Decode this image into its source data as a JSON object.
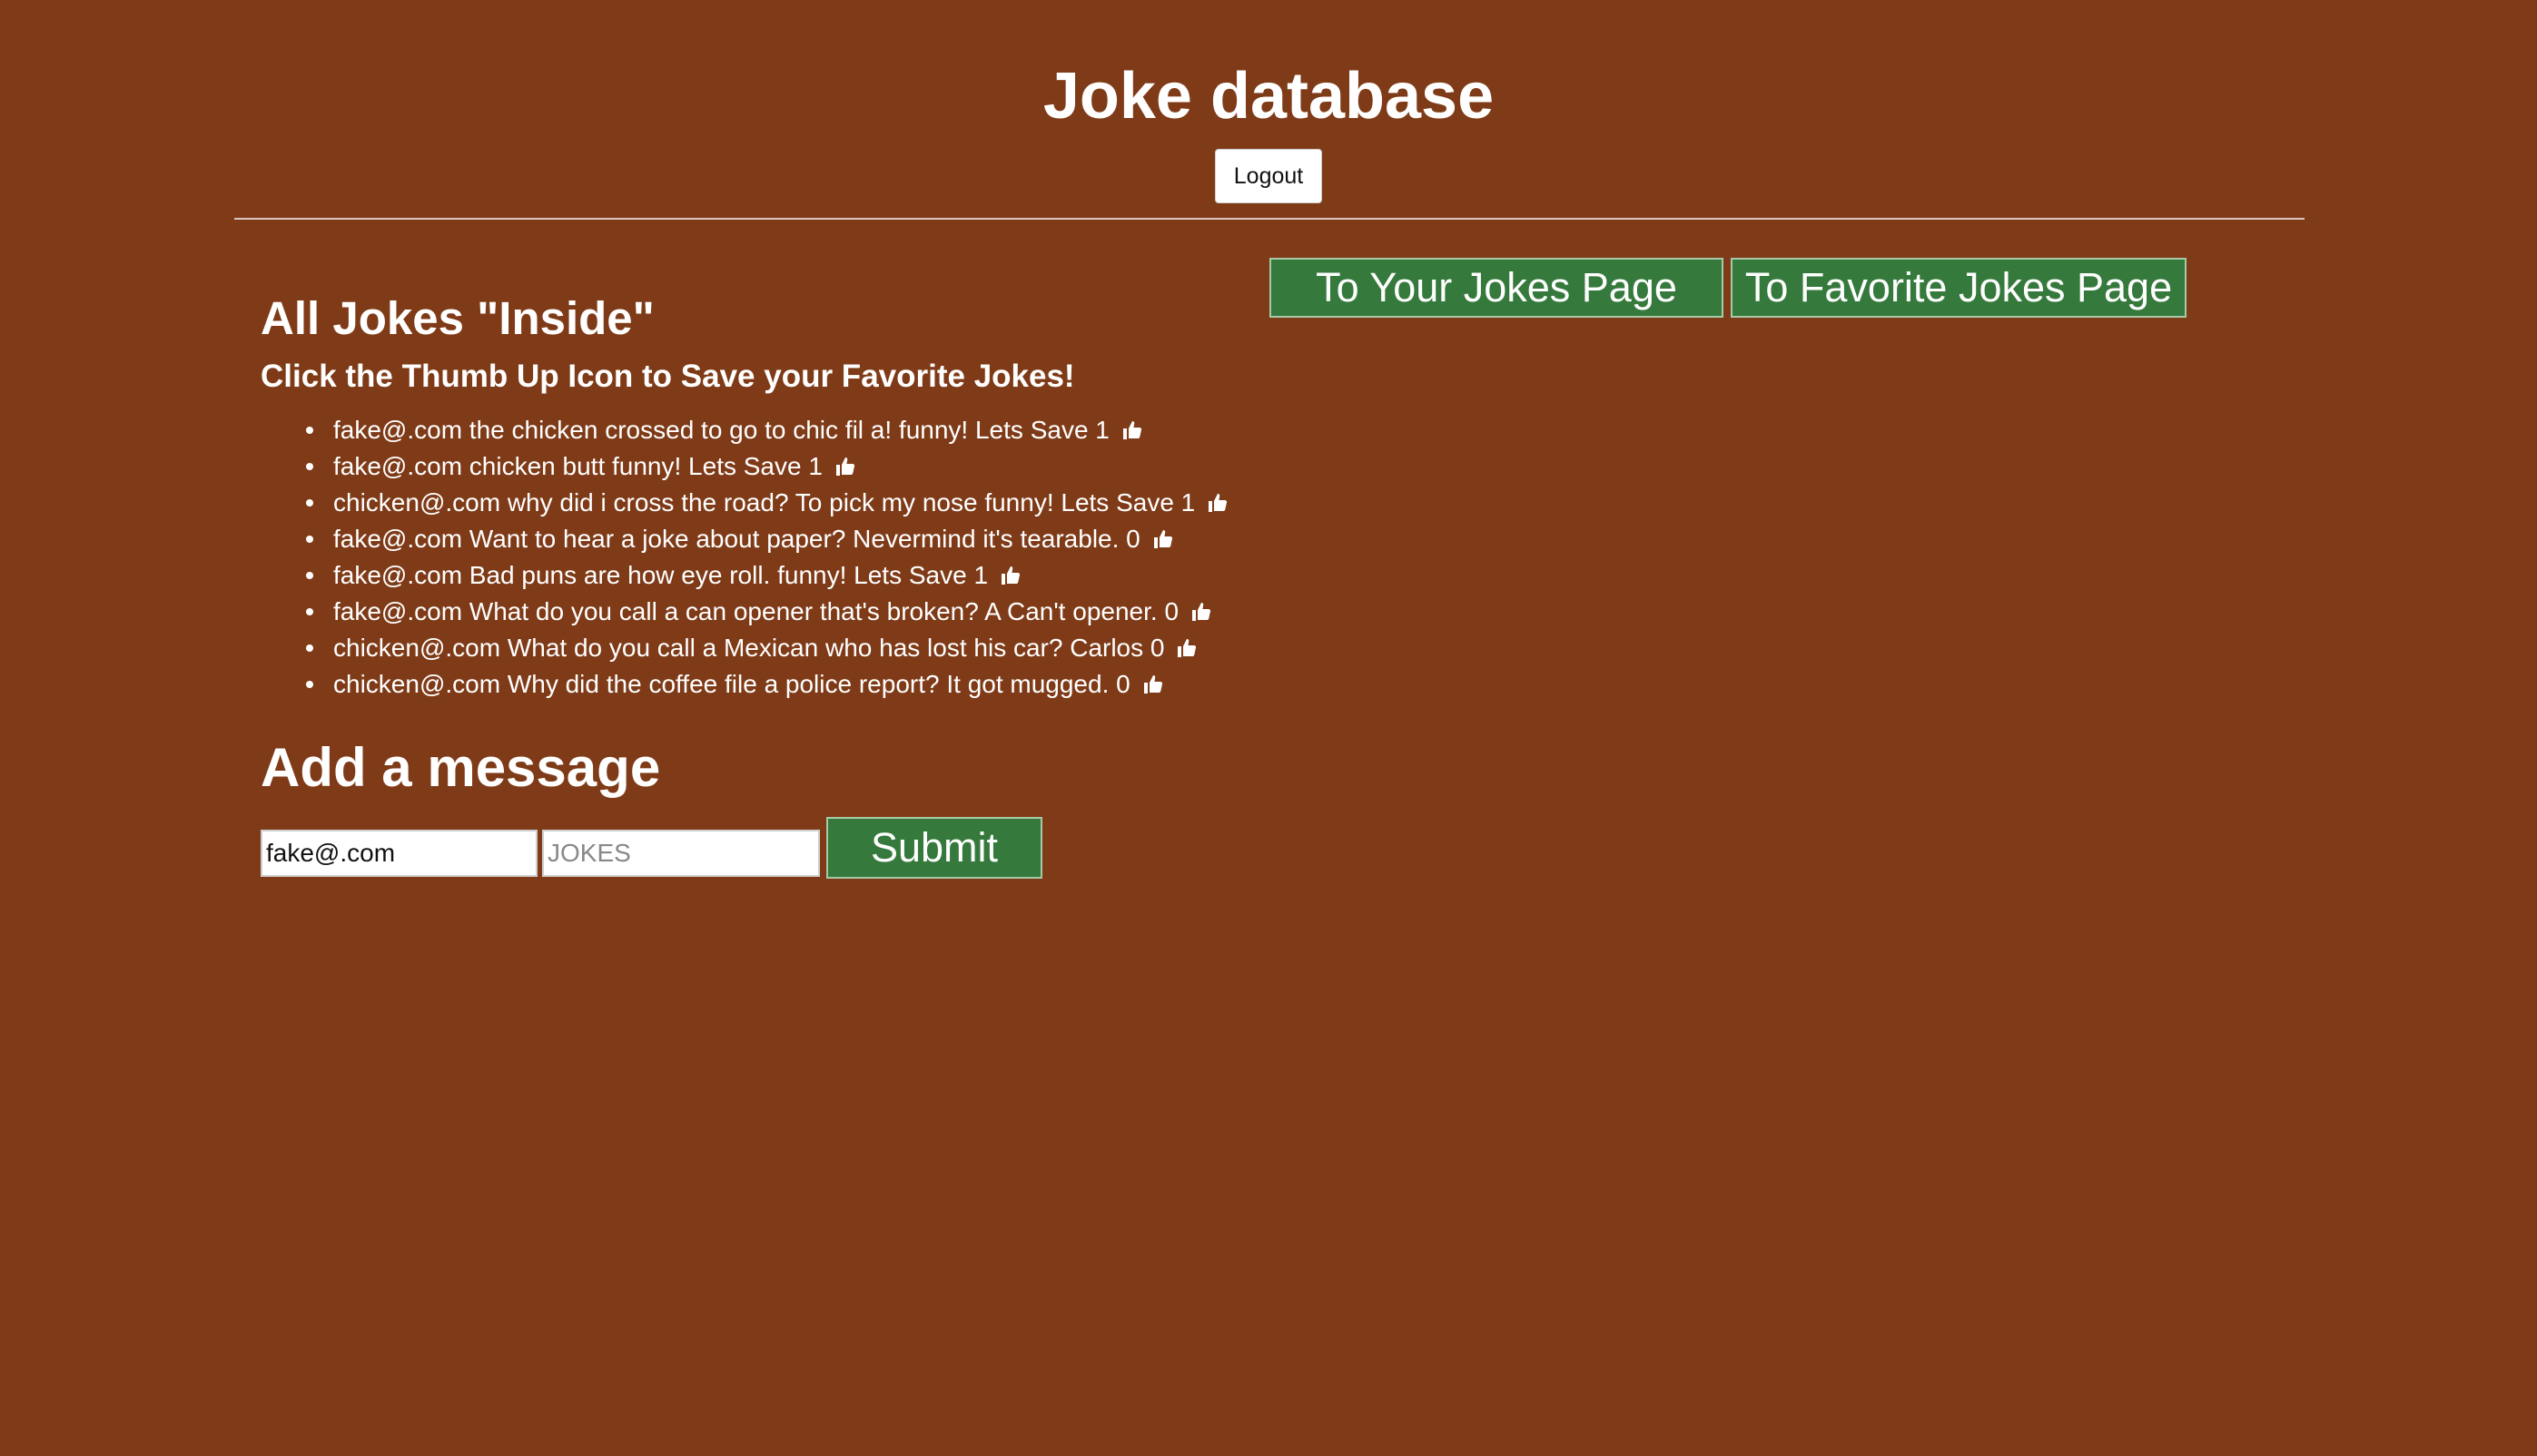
{
  "header": {
    "title": "Joke database",
    "logout_label": "Logout"
  },
  "nav": {
    "your_jokes_label": "To Your Jokes Page",
    "favorite_jokes_label": "To Favorite Jokes Page"
  },
  "jokes_section": {
    "title": "All Jokes \"Inside\"",
    "instruction": "Click the Thumb Up Icon to Save your Favorite Jokes!",
    "items": [
      {
        "text": "fake@.com the chicken crossed to go to chic fil a! funny! Lets Save 1",
        "icon": "thumbs-up-icon"
      },
      {
        "text": "fake@.com chicken butt funny! Lets Save 1",
        "icon": "thumbs-up-icon"
      },
      {
        "text": "chicken@.com why did i cross the road? To pick my nose funny! Lets Save 1",
        "icon": "thumbs-up-icon"
      },
      {
        "text": "fake@.com Want to hear a joke about paper? Nevermind it's tearable. 0",
        "icon": "thumbs-up-icon"
      },
      {
        "text": "fake@.com Bad puns are how eye roll. funny! Lets Save 1",
        "icon": "thumbs-up-icon"
      },
      {
        "text": "fake@.com What do you call a can opener that's broken? A Can't opener. 0",
        "icon": "thumbs-up-icon"
      },
      {
        "text": "chicken@.com What do you call a Mexican who has lost his car? Carlos 0",
        "icon": "thumbs-up-icon"
      },
      {
        "text": "chicken@.com Why did the coffee file a police report? It got mugged. 0",
        "icon": "thumbs-up-icon"
      }
    ]
  },
  "message_form": {
    "title": "Add a message",
    "email_value": "fake@.com",
    "joke_placeholder": "JOKES",
    "submit_label": "Submit"
  },
  "colors": {
    "background": "#7f3b18",
    "button_green": "#357a3c",
    "text": "#ffffff"
  }
}
